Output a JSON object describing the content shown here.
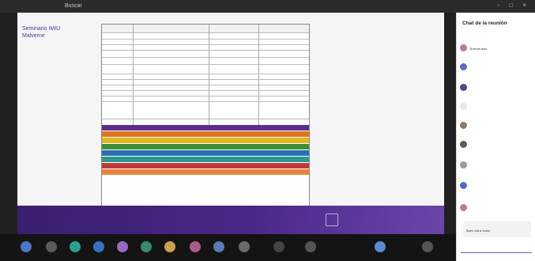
{
  "topbar": {
    "search_text": "Buscar",
    "window_controls": "- □ ×"
  },
  "slide": {
    "title": "Seminario IMIU\nMalverne",
    "table_headers": [
      "",
      "",
      "",
      ""
    ],
    "table_rows": [
      {
        "cells": [
          "",
          "",
          "",
          ""
        ]
      },
      {
        "cells": [
          "",
          "",
          "",
          ""
        ]
      },
      {
        "cells": [
          "",
          "",
          "",
          ""
        ]
      },
      {
        "cells": [
          "",
          "",
          "",
          ""
        ]
      },
      {
        "cells": [
          "",
          "",
          "",
          ""
        ]
      },
      {
        "cells": [
          "",
          "",
          "",
          ""
        ]
      },
      {
        "cells": [
          "",
          "",
          "",
          ""
        ]
      },
      {
        "cells": [
          "",
          "",
          "",
          ""
        ]
      },
      {
        "cells": [
          "",
          "",
          "",
          ""
        ]
      },
      {
        "cells": [
          "",
          "",
          "",
          ""
        ]
      },
      {
        "cells": [
          "",
          "",
          "",
          ""
        ]
      },
      {
        "cells": [
          "",
          "",
          "",
          ""
        ]
      },
      {
        "cells": [
          "",
          "",
          "",
          ""
        ]
      }
    ],
    "bands": [
      {
        "color": "#5b2d8c",
        "cells": [
          "",
          ""
        ]
      },
      {
        "color": "#e0731d",
        "cells": [
          "",
          ""
        ]
      },
      {
        "color": "#e6b420",
        "cells": [
          "",
          ""
        ]
      },
      {
        "color": "#3f8f3a",
        "cells": [
          "",
          ""
        ]
      },
      {
        "color": "#2a6fb0",
        "cells": [
          "",
          ""
        ]
      },
      {
        "color": "#2a9a8e",
        "cells": [
          "",
          ""
        ]
      },
      {
        "color": "#c23a3a",
        "cells": [
          "",
          ""
        ]
      },
      {
        "color": "#e8843a",
        "cells": [
          "",
          ""
        ]
      },
      {
        "color": "#ffffff",
        "cells": [
          "",
          "",
          ""
        ]
      }
    ],
    "footer_logo_text": "",
    "stage_controls": ""
  },
  "chat": {
    "title": "Chat de la reunión",
    "subtitle": "",
    "messages": [
      {
        "name": "",
        "text": "Buenos días",
        "avatar_color": "#b77aa8"
      },
      {
        "name": "",
        "text": "",
        "avatar_color": "#5c6bc0"
      },
      {
        "name": "",
        "text": "",
        "avatar_color": "#4a4a8c"
      },
      {
        "name": "",
        "text": "",
        "avatar_color": "#e8e8e8"
      },
      {
        "name": "",
        "text": "",
        "avatar_color": "#8c7a6a"
      },
      {
        "name": "",
        "text": "",
        "avatar_color": "#6a5a4a"
      },
      {
        "name": "",
        "text": "",
        "avatar_color": "#9a9a9a"
      },
      {
        "name": "",
        "text": "",
        "avatar_color": "#5c6bc0"
      },
      {
        "name": "",
        "text": "",
        "avatar_color": "#c07a9a"
      }
    ],
    "reply": {
      "name": "",
      "text": "Buen día a todos"
    },
    "compose_placeholder": "",
    "compose_icons": ""
  },
  "participants": [
    {
      "color": "#4a78c8"
    },
    {
      "color": "#5a5a5a"
    },
    {
      "color": "#2e9e8e"
    },
    {
      "color": "#3a6fc0"
    },
    {
      "color": "#9a6ac0"
    },
    {
      "color": "#3a8a6a"
    },
    {
      "color": "#c8a050"
    },
    {
      "color": "#aa5a8a"
    },
    {
      "color": "#5a7ab0"
    },
    {
      "color": "#6a6a6a"
    },
    {
      "color": "#444444"
    },
    {
      "color": "#555555"
    },
    {
      "color": "#5a8ad0"
    },
    {
      "color": "#555555"
    }
  ]
}
